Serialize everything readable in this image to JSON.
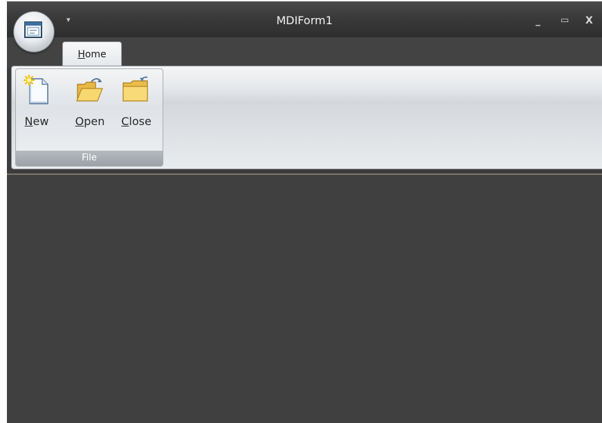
{
  "window": {
    "title": "MDIForm1",
    "quick_access_glyph": "▾",
    "controls": {
      "minimize": "_",
      "maximize": "▭",
      "close": "X"
    }
  },
  "ribbon": {
    "tabs": [
      {
        "label": "Home",
        "accelerator": "H",
        "rest": "ome",
        "selected": true
      }
    ],
    "groups": [
      {
        "label": "File",
        "buttons": [
          {
            "label": "New",
            "accelerator": "N",
            "rest": "ew",
            "icon": "new-document-icon"
          },
          {
            "label": "Open",
            "accelerator": "O",
            "rest": "pen",
            "icon": "open-folder-icon"
          },
          {
            "label": "Close",
            "accelerator": "C",
            "rest": "lose",
            "icon": "close-folder-icon"
          }
        ]
      }
    ]
  },
  "colors": {
    "titlebar": "#3a3a3a",
    "workspace": "#404040",
    "ribbon_body": "#e6e9ec",
    "group_label_bg": "#a4aaaf"
  }
}
